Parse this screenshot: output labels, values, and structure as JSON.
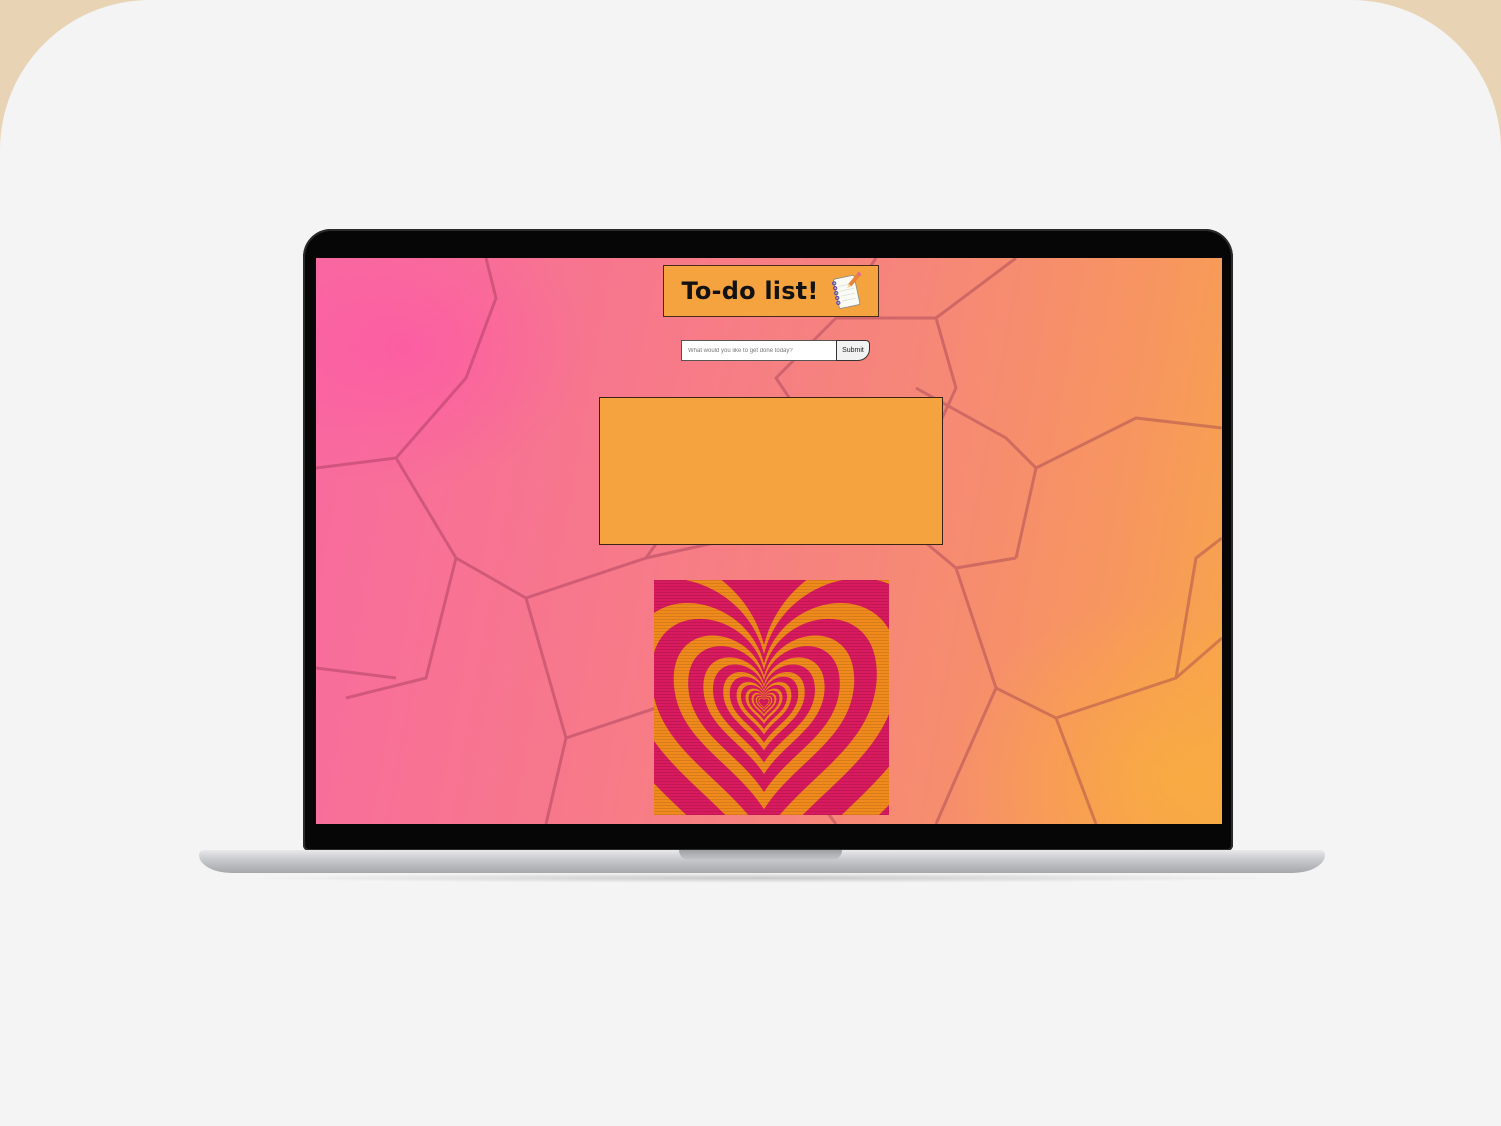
{
  "app": {
    "title": "To-do list!",
    "title_icon": "notepad-icon"
  },
  "form": {
    "input_placeholder": "What would you like to get done today?",
    "input_value": "",
    "submit_label": "Submit"
  },
  "list": {
    "items": []
  },
  "decor": {
    "image": "heart-pattern-image"
  },
  "colors": {
    "panel_orange": "#f4a33f",
    "background_pink": "#f86aa0",
    "background_orange": "#f7a64a",
    "heart_magenta": "#d81a5e",
    "heart_orange": "#f08a1c",
    "bezel": "#060606"
  }
}
